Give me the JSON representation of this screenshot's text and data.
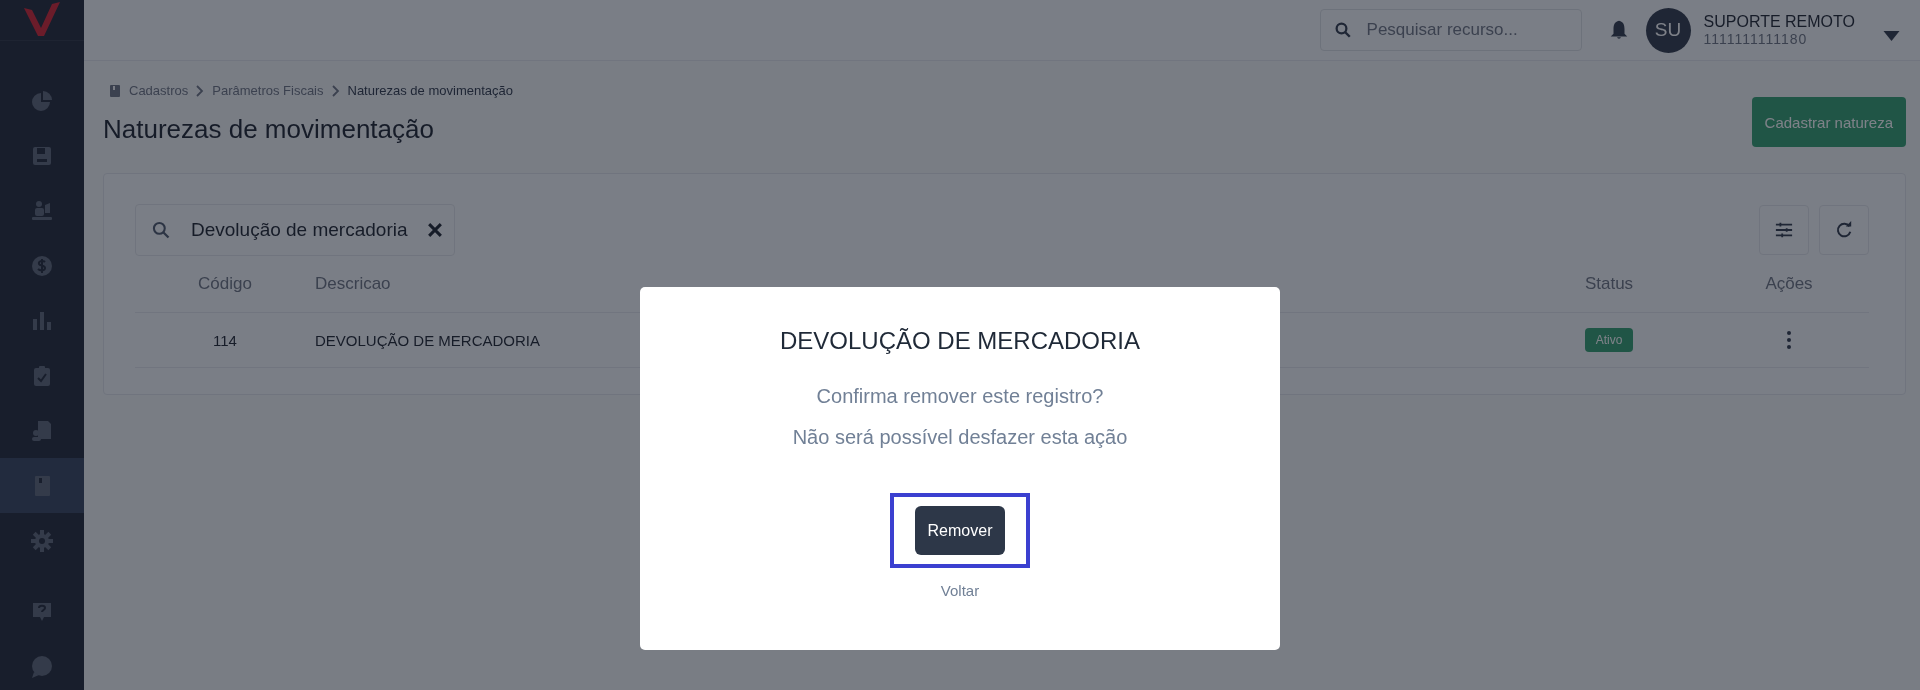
{
  "sidebar": {
    "items": [
      {
        "kind": "pie",
        "selected": false
      },
      {
        "kind": "save",
        "selected": false
      },
      {
        "kind": "people",
        "selected": false
      },
      {
        "kind": "dollar",
        "selected": false
      },
      {
        "kind": "bars",
        "selected": false
      },
      {
        "kind": "clipboard",
        "selected": false
      },
      {
        "kind": "document",
        "selected": false
      },
      {
        "kind": "book",
        "selected": true
      },
      {
        "kind": "gear",
        "selected": false
      }
    ],
    "bottom_items": [
      {
        "kind": "help",
        "selected": false
      },
      {
        "kind": "chat",
        "selected": false
      }
    ]
  },
  "header": {
    "search": {
      "placeholder": "Pesquisar recurso..."
    },
    "user": {
      "initials": "SU",
      "name": "SUPORTE REMOTO",
      "id": "1111111111180"
    }
  },
  "breadcrumb": [
    "Cadastros",
    "Parâmetros Fiscais",
    "Naturezas de movimentação"
  ],
  "page_title": "Naturezas de movimentação",
  "primary_button": "Cadastrar natureza",
  "filter": {
    "value": "Devolução de mercadoria"
  },
  "table": {
    "columns": [
      "Código",
      "Descricao",
      "Status",
      "Ações"
    ],
    "rows": [
      {
        "codigo": "114",
        "descricao": "DEVOLUÇÃO DE MERCADORIA",
        "status": "Ativo"
      }
    ]
  },
  "modal": {
    "title": "DEVOLUÇÃO DE MERCADORIA",
    "lines": [
      "Confirma remover este registro?",
      "Não será possível desfazer esta ação"
    ],
    "confirm": {
      "label": "Remover",
      "focused": true
    },
    "cancel": "Voltar"
  }
}
